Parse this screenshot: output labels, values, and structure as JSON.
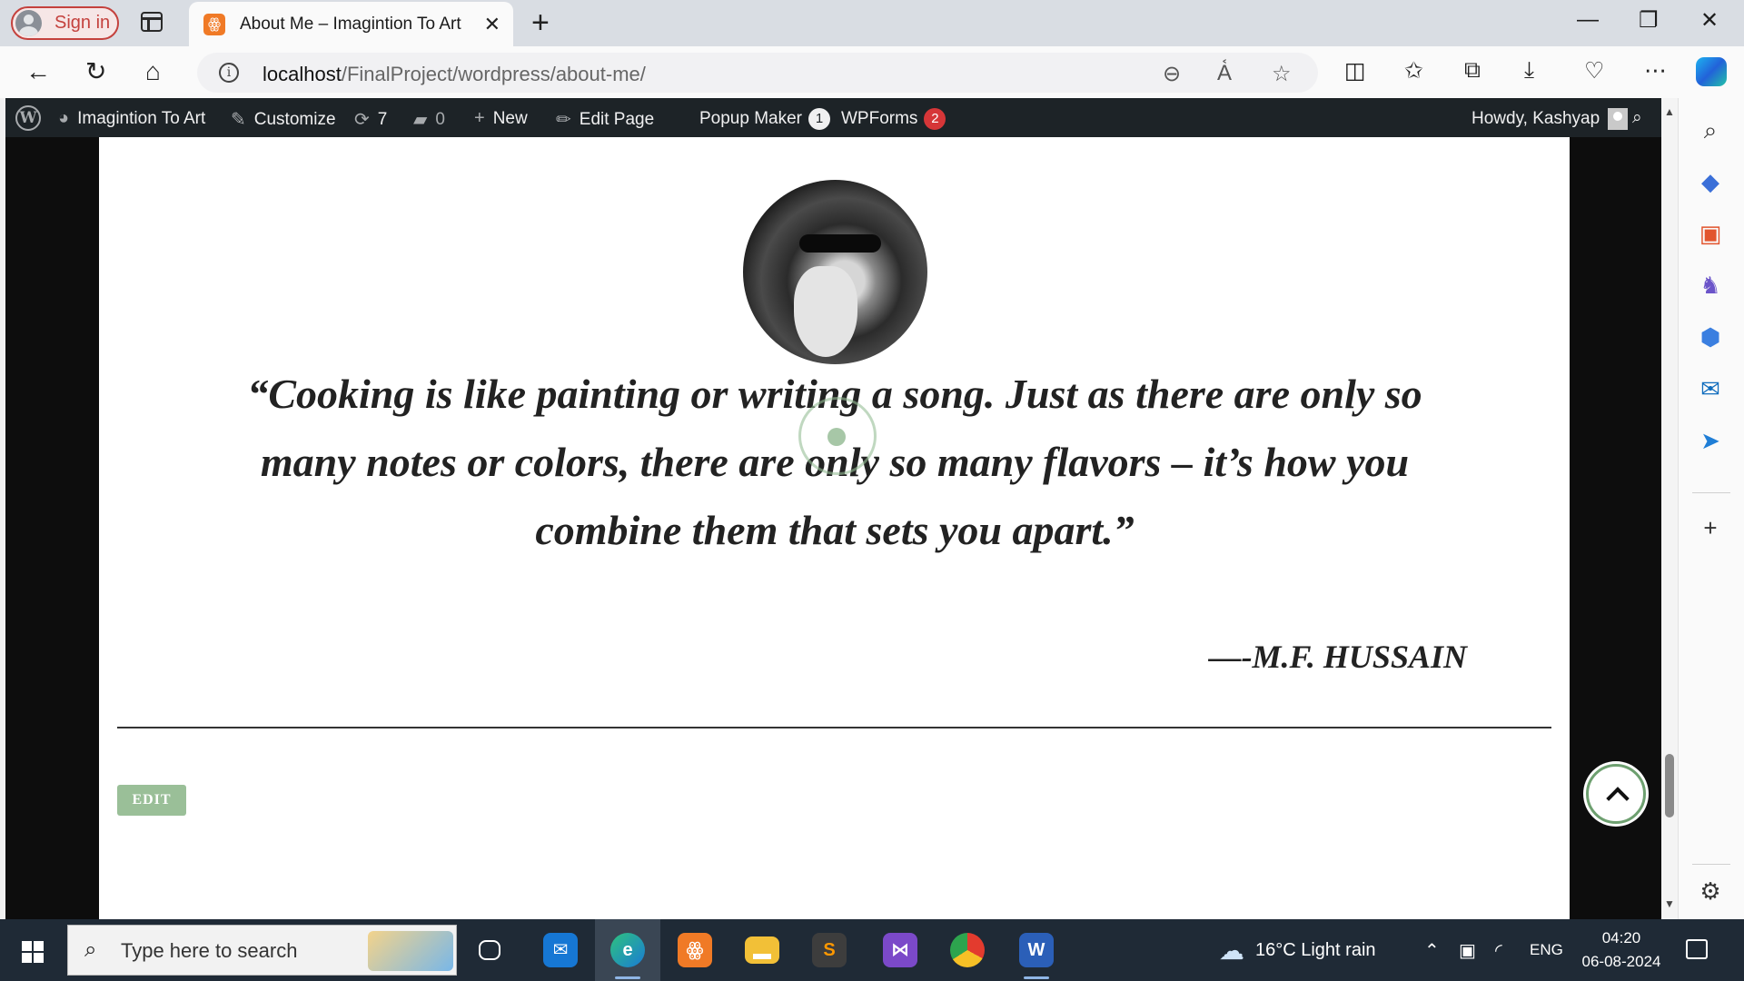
{
  "browser": {
    "sign_in_label": "Sign in",
    "tab_title": "About Me – Imagintion To Art",
    "url_host": "localhost",
    "url_path": "/FinalProject/wordpress/about-me/"
  },
  "admin_bar": {
    "site_name": "Imagintion To Art",
    "customize": "Customize",
    "updates_count": "7",
    "comments_count": "0",
    "new_label": "New",
    "edit_page": "Edit Page",
    "popup_maker": "Popup Maker",
    "popup_maker_badge": "1",
    "wpforms": "WPForms",
    "wpforms_badge": "2",
    "howdy": "Howdy, Kashyap"
  },
  "page": {
    "quote": "“Cooking is like painting or writing a song. Just as there are only so many notes or colors, there are only so many flavors – it’s how you combine them that sets you apart.”",
    "author": "—-M.F. HUSSAIN",
    "edit_label": "EDIT"
  },
  "taskbar": {
    "search_placeholder": "Type here to search",
    "weather": "16°C  Light rain",
    "language": "ENG",
    "time": "04:20",
    "date": "06-08-2024"
  },
  "colors": {
    "admin_bar_bg": "#1d2327",
    "edit_button_bg": "#9abf98",
    "badge_red": "#d63638",
    "signin_red": "#c4413d"
  }
}
